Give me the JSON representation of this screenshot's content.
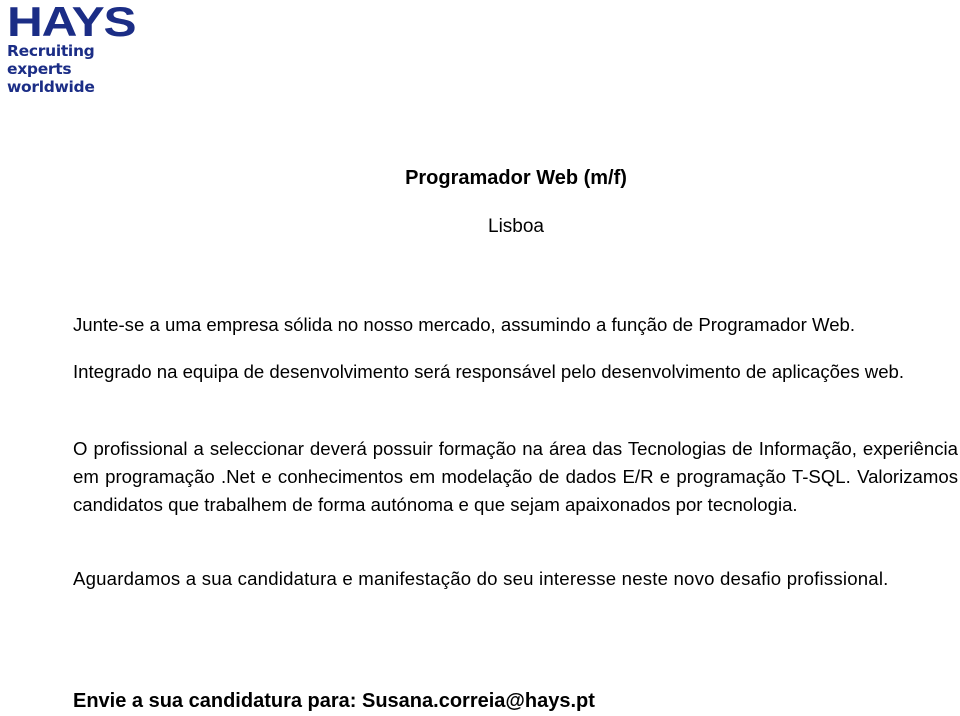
{
  "brand": {
    "name": "HAYS",
    "tagline_line1": "Recruiting experts",
    "tagline_line2": "worldwide",
    "color": "#1b2d86"
  },
  "job": {
    "title": "Programador Web (m/f)",
    "location": "Lisboa"
  },
  "body": {
    "paragraphs": [
      "Junte-se a uma empresa sólida no nosso mercado, assumindo a função de Programador Web.",
      "Integrado na equipa de desenvolvimento será responsável pelo desenvolvimento de aplicações web.",
      "O profissional a seleccionar deverá possuir formação na área das Tecnologias de Informação, experiência em programação .Net e conhecimentos em modelação de dados E/R e programação T-SQL. Valorizamos candidatos que trabalhem de forma autónoma e que sejam apaixonados por tecnologia.",
      "Aguardamos a sua candidatura e manifestação do seu interesse neste novo desafio profissional."
    ]
  },
  "contact": {
    "text": "Envie a sua candidatura para: Susana.correia@hays.pt"
  }
}
